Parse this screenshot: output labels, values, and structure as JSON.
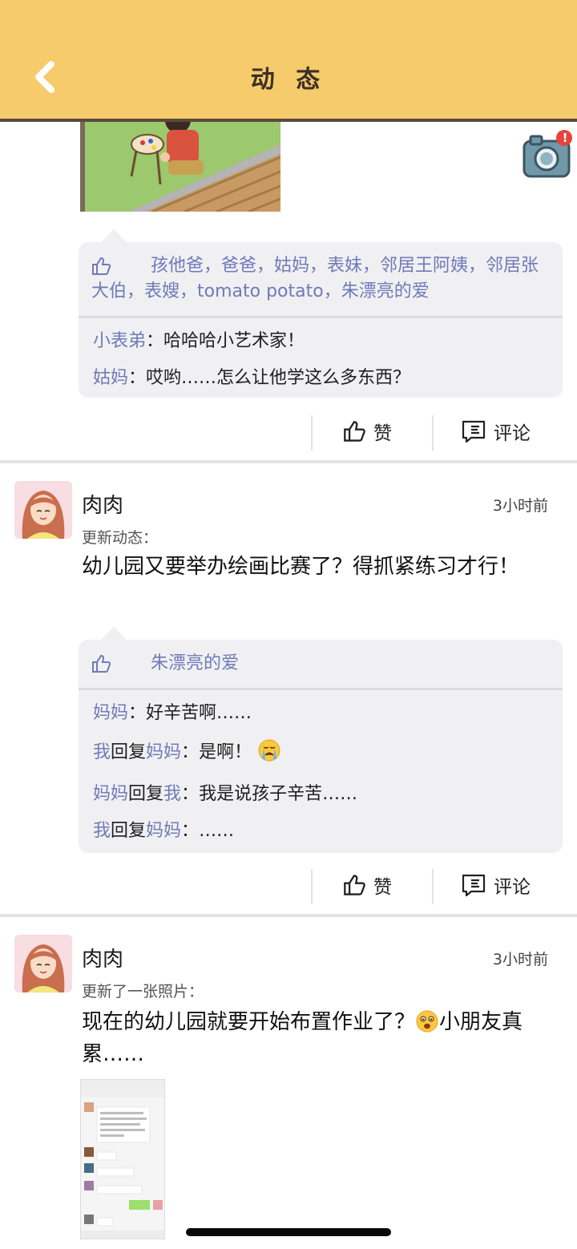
{
  "header": {
    "title": "动 态",
    "back_icon": "chevron-left-icon",
    "bg_color": "#f6cb6b"
  },
  "camera": {
    "icon": "camera-icon",
    "badge": "!"
  },
  "post1": {
    "likes": "孩他爸，爸爸，姑妈，表妹，邻居王阿姨，邻居张大伯，表嫂，tomato potato，朱漂亮的爱",
    "comments": [
      {
        "name": "小表弟",
        "sep": "：",
        "text": "哈哈哈小艺术家！"
      },
      {
        "name": "姑妈",
        "sep": "：",
        "text": "哎哟……怎么让他学这么多东西？"
      }
    ],
    "like_label": "赞",
    "comment_label": "评论"
  },
  "post2": {
    "username": "肉肉",
    "time": "3小时前",
    "type": "更新动态：",
    "text": "幼儿园又要举办绘画比赛了？得抓紧练习才行！",
    "likes": "朱漂亮的爱",
    "comments": [
      {
        "name": "妈妈",
        "sep": "：",
        "text": "好辛苦啊……"
      },
      {
        "name": "我",
        "mid": "回复",
        "name2": "妈妈",
        "sep": "：",
        "text": "是啊！"
      },
      {
        "name": "妈妈",
        "mid": "回复",
        "name2": "我",
        "sep": "：",
        "text": "我是说孩子辛苦……"
      },
      {
        "name": "我",
        "mid": "回复",
        "name2": "妈妈",
        "sep": "：",
        "text": "……"
      }
    ],
    "like_label": "赞",
    "comment_label": "评论"
  },
  "post3": {
    "username": "肉肉",
    "time": "3小时前",
    "type": "更新了一张照片：",
    "text_a": "现在的幼儿园就要开始布置作业了？",
    "text_b": "小朋友真累……"
  },
  "colors": {
    "name_link": "#6f7ab8",
    "bubble": "#f0f0f2"
  }
}
